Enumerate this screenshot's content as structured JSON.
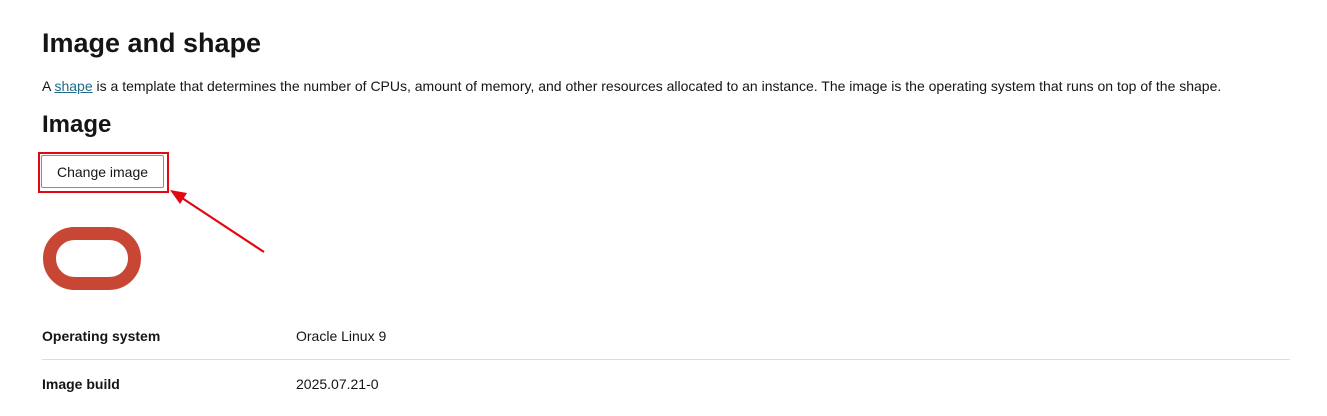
{
  "section": {
    "title": "Image and shape",
    "description_prefix": "A ",
    "description_link": "shape",
    "description_suffix": " is a template that determines the number of CPUs, amount of memory, and other resources allocated to an instance. The image is the operating system that runs on top of the shape."
  },
  "image": {
    "title": "Image",
    "change_button_label": "Change image",
    "logo_icon": "oracle-logo-icon",
    "logo_color": "#C74634",
    "annotation_color": "#E30613"
  },
  "details": [
    {
      "label": "Operating system",
      "value": "Oracle Linux 9"
    },
    {
      "label": "Image build",
      "value": "2025.07.21-0"
    }
  ]
}
